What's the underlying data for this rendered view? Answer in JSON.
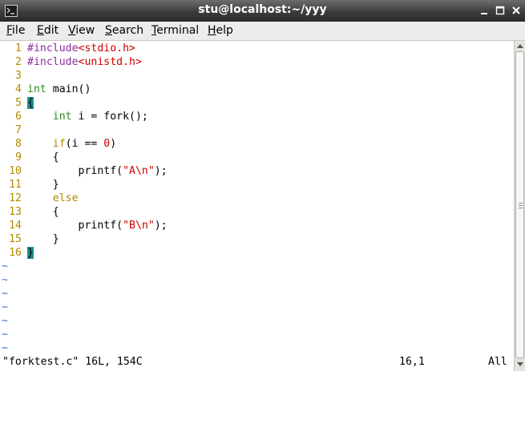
{
  "window": {
    "title": "stu@localhost:~/yyy",
    "icon": "terminal-icon",
    "controls": [
      "minimize-icon",
      "maximize-icon",
      "close-icon"
    ]
  },
  "menubar": {
    "items": [
      {
        "label": "File",
        "mnemonic": "F",
        "rest": "ile"
      },
      {
        "label": "Edit",
        "mnemonic": "E",
        "rest": "dit"
      },
      {
        "label": "View",
        "mnemonic": "V",
        "rest": "iew"
      },
      {
        "label": "Search",
        "mnemonic": "S",
        "rest": "earch"
      },
      {
        "label": "Terminal",
        "mnemonic": "T",
        "rest": "erminal"
      },
      {
        "label": "Help",
        "mnemonic": "H",
        "rest": "elp"
      }
    ]
  },
  "editor": {
    "lines": [
      {
        "num": "1",
        "tokens": [
          {
            "t": "#include",
            "c": "pre"
          },
          {
            "t": "<stdio.h>",
            "c": "str"
          }
        ]
      },
      {
        "num": "2",
        "tokens": [
          {
            "t": "#include",
            "c": "pre"
          },
          {
            "t": "<unistd.h>",
            "c": "str"
          }
        ]
      },
      {
        "num": "3",
        "tokens": []
      },
      {
        "num": "4",
        "tokens": [
          {
            "t": "int",
            "c": "kw-type"
          },
          {
            "t": " main()",
            "c": ""
          }
        ]
      },
      {
        "num": "5",
        "tokens": [
          {
            "t": "{",
            "c": "brace-hl"
          }
        ]
      },
      {
        "num": "6",
        "tokens": [
          {
            "t": "    ",
            "c": ""
          },
          {
            "t": "int",
            "c": "kw-type"
          },
          {
            "t": " i = fork();",
            "c": ""
          }
        ]
      },
      {
        "num": "7",
        "tokens": []
      },
      {
        "num": "8",
        "tokens": [
          {
            "t": "    ",
            "c": ""
          },
          {
            "t": "if",
            "c": "kw-ctl"
          },
          {
            "t": "(i == ",
            "c": ""
          },
          {
            "t": "0",
            "c": "num"
          },
          {
            "t": ")",
            "c": ""
          }
        ]
      },
      {
        "num": "9",
        "tokens": [
          {
            "t": "    {",
            "c": ""
          }
        ]
      },
      {
        "num": "10",
        "tokens": [
          {
            "t": "        printf(",
            "c": ""
          },
          {
            "t": "\"A\\n\"",
            "c": "str"
          },
          {
            "t": ");",
            "c": ""
          }
        ]
      },
      {
        "num": "11",
        "tokens": [
          {
            "t": "    }",
            "c": ""
          }
        ]
      },
      {
        "num": "12",
        "tokens": [
          {
            "t": "    ",
            "c": ""
          },
          {
            "t": "else",
            "c": "kw-ctl"
          }
        ]
      },
      {
        "num": "13",
        "tokens": [
          {
            "t": "    {",
            "c": ""
          }
        ]
      },
      {
        "num": "14",
        "tokens": [
          {
            "t": "        printf(",
            "c": ""
          },
          {
            "t": "\"B\\n\"",
            "c": "str"
          },
          {
            "t": ");",
            "c": ""
          }
        ]
      },
      {
        "num": "15",
        "tokens": [
          {
            "t": "    }",
            "c": ""
          }
        ]
      },
      {
        "num": "16",
        "tokens": [
          {
            "t": "}",
            "c": "brace-hl"
          }
        ]
      }
    ],
    "empty_marker": "~",
    "empty_lines": 7
  },
  "status": {
    "file_info": "\"forktest.c\" 16L, 154C",
    "cursor_pos": "16,1",
    "scroll_pct": "All"
  },
  "colors": {
    "line_number": "#b08b00",
    "type_keyword": "#2e8b22",
    "control_keyword": "#b08b00",
    "preprocessor": "#8a2f9c",
    "string": "#cc0000",
    "brace_highlight": "#1f8f8f",
    "tilde": "#3a6fd8"
  }
}
